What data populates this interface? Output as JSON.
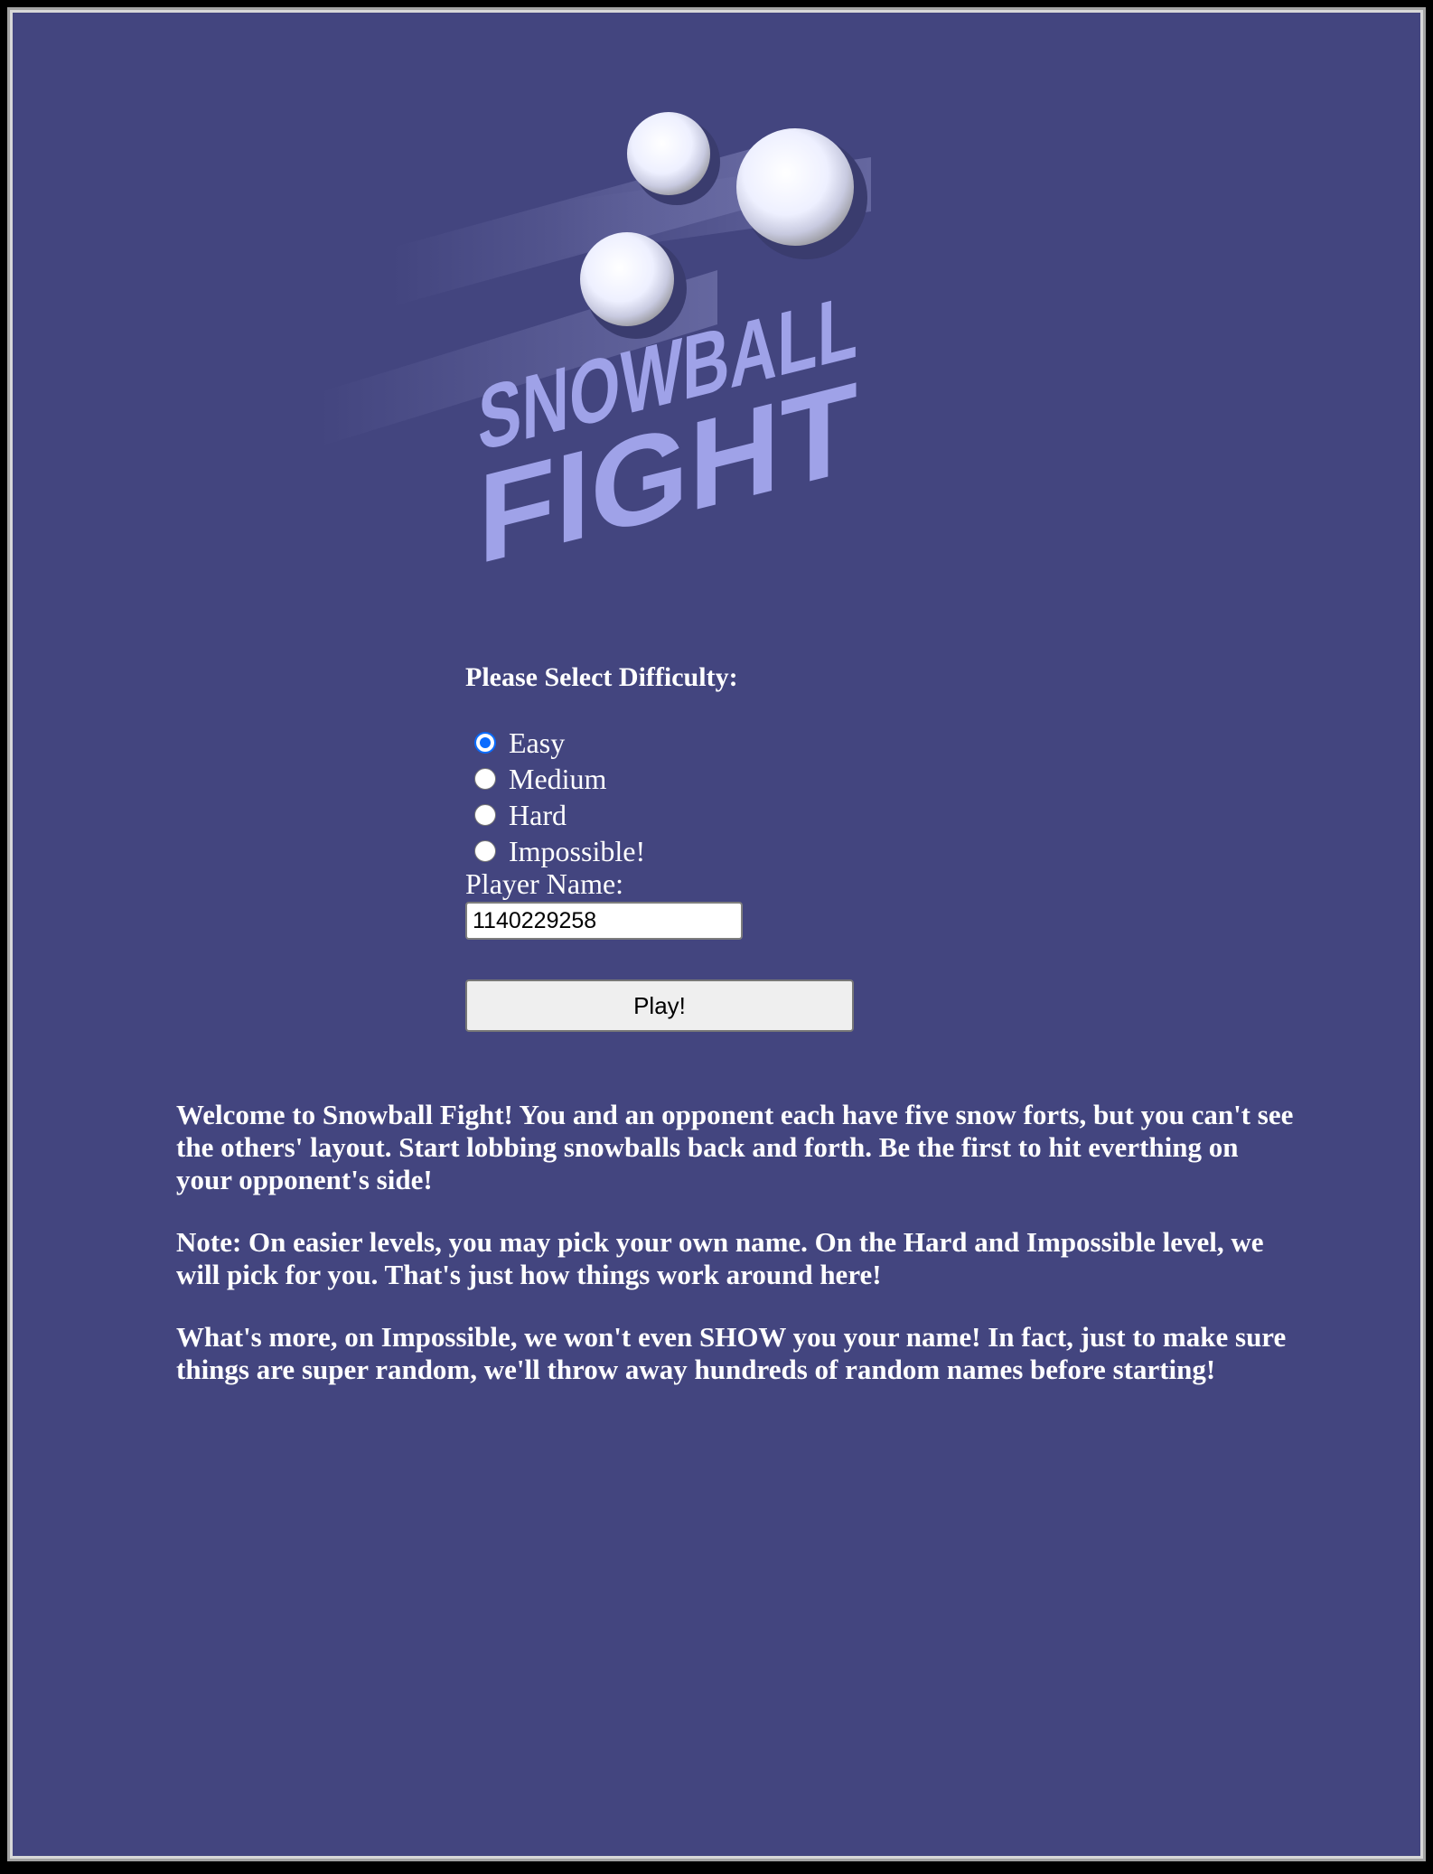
{
  "logo": {
    "line1": "SNOWBALL",
    "line2": "FIGHT"
  },
  "difficulty": {
    "title": "Please Select Difficulty:",
    "options": [
      {
        "label": "Easy",
        "checked": true
      },
      {
        "label": "Medium",
        "checked": false
      },
      {
        "label": "Hard",
        "checked": false
      },
      {
        "label": "Impossible!",
        "checked": false
      }
    ]
  },
  "player": {
    "label": "Player Name:",
    "value": "1140229258"
  },
  "play_button": {
    "label": "Play!"
  },
  "info": {
    "paragraphs": [
      "Welcome to Snowball Fight! You and an opponent each have five snow forts, but you can't see the others' layout. Start lobbing snowballs back and forth. Be the first to hit everthing on your opponent's side!",
      "Note: On easier levels, you may pick your own name. On the Hard and Impossible level, we will pick for you. That's just how things work around here!",
      "What's more, on Impossible, we won't even SHOW you your name! In fact, just to make sure things are super random, we'll throw away hundreds of random names before starting!"
    ]
  },
  "colors": {
    "background": "#43457f",
    "logo_text": "#9fa2e8",
    "radio_checked": "#0a6cff"
  }
}
